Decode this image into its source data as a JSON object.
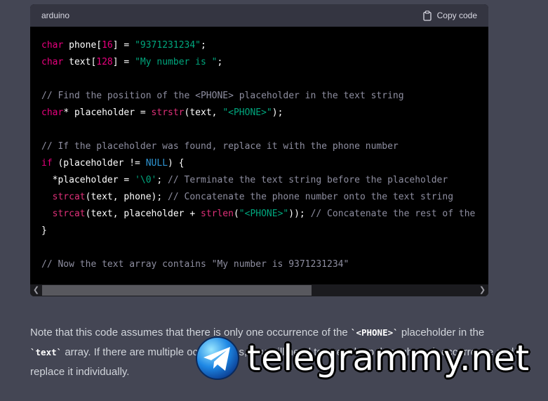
{
  "code_block": {
    "language": "arduino",
    "copy_label": "Copy code",
    "lines": [
      [
        {
          "t": "kw",
          "v": "char"
        },
        {
          "t": "p",
          "v": " phone["
        },
        {
          "t": "num",
          "v": "16"
        },
        {
          "t": "p",
          "v": "] = "
        },
        {
          "t": "str",
          "v": "\"9371231234\""
        },
        {
          "t": "p",
          "v": ";"
        }
      ],
      [
        {
          "t": "kw",
          "v": "char"
        },
        {
          "t": "p",
          "v": " text["
        },
        {
          "t": "num",
          "v": "128"
        },
        {
          "t": "p",
          "v": "] = "
        },
        {
          "t": "str",
          "v": "\"My number is \""
        },
        {
          "t": "p",
          "v": ";"
        }
      ],
      [],
      [
        {
          "t": "cm",
          "v": "// Find the position of the <PHONE> placeholder in the text string"
        }
      ],
      [
        {
          "t": "kw",
          "v": "char"
        },
        {
          "t": "p",
          "v": "* placeholder = "
        },
        {
          "t": "fn",
          "v": "strstr"
        },
        {
          "t": "p",
          "v": "(text, "
        },
        {
          "t": "str",
          "v": "\"<PHONE>\""
        },
        {
          "t": "p",
          "v": ");"
        }
      ],
      [],
      [
        {
          "t": "cm",
          "v": "// If the placeholder was found, replace it with the phone number"
        }
      ],
      [
        {
          "t": "kw",
          "v": "if"
        },
        {
          "t": "p",
          "v": " (placeholder != "
        },
        {
          "t": "nl",
          "v": "NULL"
        },
        {
          "t": "p",
          "v": ") {"
        }
      ],
      [
        {
          "t": "p",
          "v": "  *placeholder = "
        },
        {
          "t": "str",
          "v": "'\\0'"
        },
        {
          "t": "p",
          "v": "; "
        },
        {
          "t": "cm",
          "v": "// Terminate the text string before the placeholder"
        }
      ],
      [
        {
          "t": "p",
          "v": "  "
        },
        {
          "t": "fn",
          "v": "strcat"
        },
        {
          "t": "p",
          "v": "(text, phone); "
        },
        {
          "t": "cm",
          "v": "// Concatenate the phone number onto the text string"
        }
      ],
      [
        {
          "t": "p",
          "v": "  "
        },
        {
          "t": "fn",
          "v": "strcat"
        },
        {
          "t": "p",
          "v": "(text, placeholder + "
        },
        {
          "t": "fn",
          "v": "strlen"
        },
        {
          "t": "p",
          "v": "("
        },
        {
          "t": "str",
          "v": "\"<PHONE>\""
        },
        {
          "t": "p",
          "v": ")); "
        },
        {
          "t": "cm",
          "v": "// Concatenate the rest of the"
        }
      ],
      [
        {
          "t": "p",
          "v": "}"
        }
      ],
      [],
      [
        {
          "t": "cm",
          "v": "// Now the text array contains \"My number is 9371231234\""
        }
      ]
    ],
    "horizontal_scroll_fraction": 0.62
  },
  "prose": {
    "p1_a": "Note that this code assumes that there is only one occurrence of the ",
    "p1_code1": "`<PHONE>`",
    "p1_b": " placeholder in the ",
    "p1_code2": "`text`",
    "p1_c": " array. If there are multiple occurrences, you will need to use a loop through each occurrence and replace it individually."
  },
  "watermark": {
    "text": "telegrammy.net"
  },
  "colors": {
    "page_bg": "#444654",
    "code_bg": "#000000",
    "header_bg": "#343541",
    "keyword": "#e9007f",
    "string": "#00a67d",
    "function": "#df3079",
    "comment": "#8e8ea0",
    "null": "#2e95d3"
  }
}
